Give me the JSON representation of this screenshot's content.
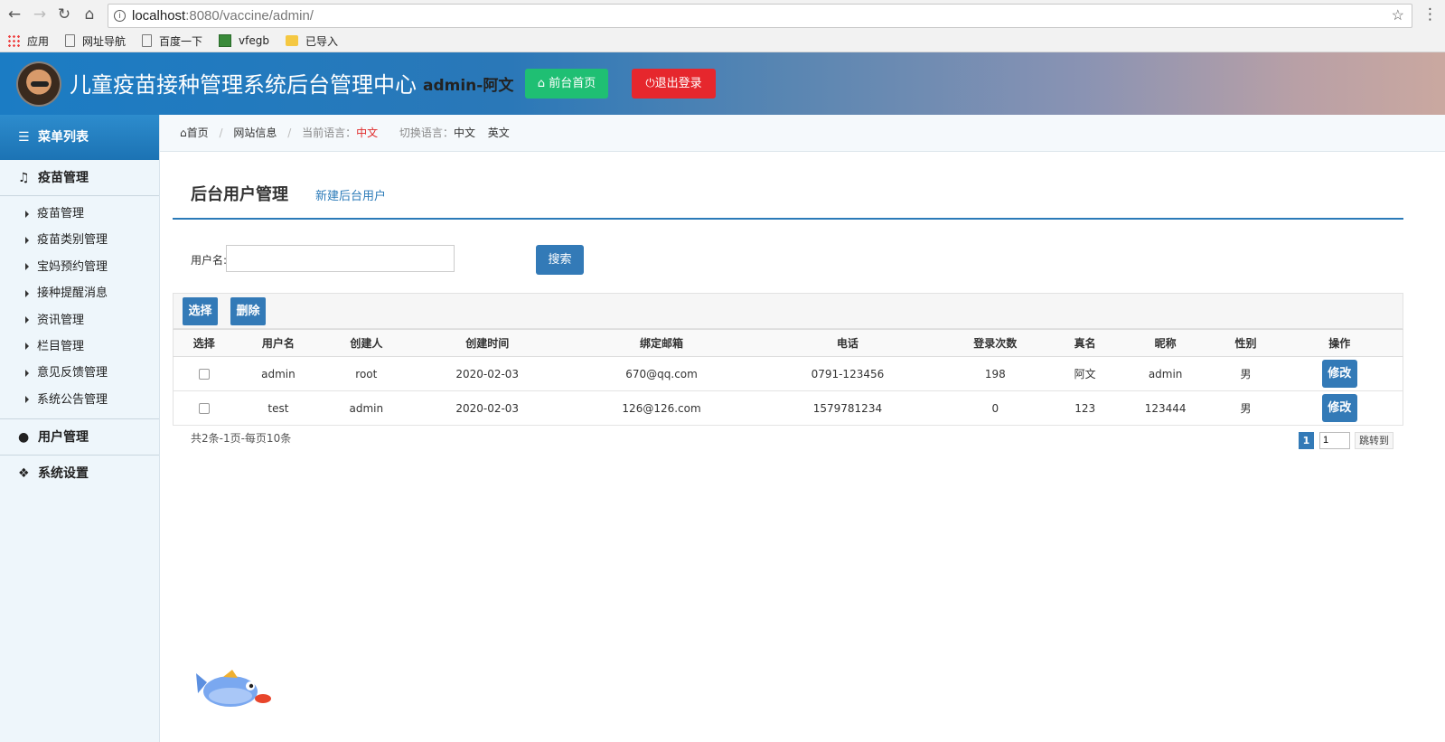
{
  "browser": {
    "url_host": "localhost",
    "url_path": ":8080/vaccine/admin/",
    "bookmarks": [
      {
        "label": "应用",
        "icon": "apps-grid-icon"
      },
      {
        "label": "网址导航",
        "icon": "page-icon"
      },
      {
        "label": "百度一下",
        "icon": "page-icon"
      },
      {
        "label": "vfegb",
        "icon": "grid-icon"
      },
      {
        "label": "已导入",
        "icon": "folder-icon"
      }
    ]
  },
  "header": {
    "title": "儿童疫苗接种管理系统后台管理中心",
    "user": "admin-阿文",
    "front_button": "前台首页",
    "logout_button": "退出登录"
  },
  "sidebar": {
    "menu_title": "菜单列表",
    "vaccine_group": "疫苗管理",
    "items": [
      "疫苗管理",
      "疫苗类别管理",
      "宝妈预约管理",
      "接种提醒消息",
      "资讯管理",
      "栏目管理",
      "意见反馈管理",
      "系统公告管理"
    ],
    "user_group": "用户管理",
    "settings_group": "系统设置"
  },
  "breadcrumb": {
    "home": "首页",
    "site_info": "网站信息",
    "current_lang_label": "当前语言：",
    "current_lang": "中文",
    "switch_label": "切换语言：",
    "lang_zh": "中文",
    "lang_en": "英文"
  },
  "main": {
    "title": "后台用户管理",
    "new_link": "新建后台用户",
    "search_label": "用户名:",
    "search_value": "",
    "search_button": "搜索",
    "select_button": "选择",
    "delete_button": "删除",
    "columns": [
      "选择",
      "用户名",
      "创建人",
      "创建时间",
      "绑定邮箱",
      "电话",
      "登录次数",
      "真名",
      "昵称",
      "性别",
      "操作"
    ],
    "rows": [
      {
        "username": "admin",
        "creator": "root",
        "created": "2020-02-03",
        "email": "670@qq.com",
        "phone": "0791-123456",
        "logins": "198",
        "realname": "阿文",
        "nickname": "admin",
        "gender": "男",
        "action": "修改"
      },
      {
        "username": "test",
        "creator": "admin",
        "created": "2020-02-03",
        "email": "126@126.com",
        "phone": "1579781234",
        "logins": "0",
        "realname": "123",
        "nickname": "123444",
        "gender": "男",
        "action": "修改"
      }
    ],
    "summary": "共2条-1页-每页10条",
    "pager": {
      "current": "1",
      "input_value": "1",
      "go_label": "跳转到"
    }
  },
  "colors": {
    "primary": "#337ab7",
    "green": "#1fbf73",
    "red": "#e6272d",
    "header_start": "#1b7cc4"
  }
}
